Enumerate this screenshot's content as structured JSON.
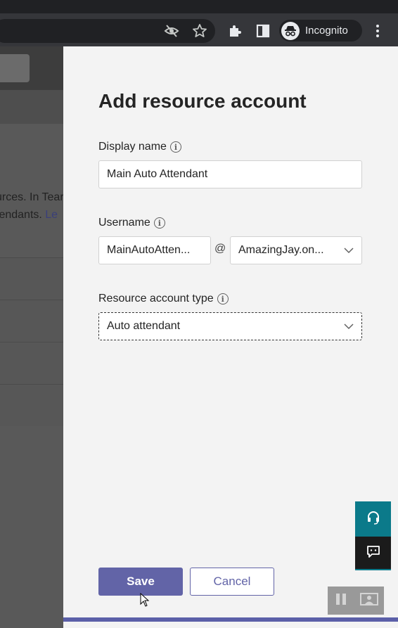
{
  "browser": {
    "profile_label": "Incognito",
    "icons": [
      "eye-off-icon",
      "star-icon",
      "extensions-icon",
      "sidepanel-icon",
      "incognito-icon",
      "kebab-menu-icon"
    ]
  },
  "background": {
    "text_line1": "urces. In Tear",
    "text_line2_prefix": "tendants.",
    "text_line2_link": "Le"
  },
  "panel": {
    "title": "Add resource account",
    "display_name": {
      "label": "Display name",
      "value": "Main Auto Attendant"
    },
    "username": {
      "label": "Username",
      "value": "MainAutoAtten...",
      "at": "@",
      "domain": "AmazingJay.on..."
    },
    "account_type": {
      "label": "Resource account type",
      "value": "Auto attendant"
    },
    "info_glyph": "i",
    "save_label": "Save",
    "cancel_label": "Cancel"
  },
  "colors": {
    "accent": "#6264a7",
    "help_teal": "#0b7a8a",
    "panel_bg": "#f3f3f3"
  }
}
